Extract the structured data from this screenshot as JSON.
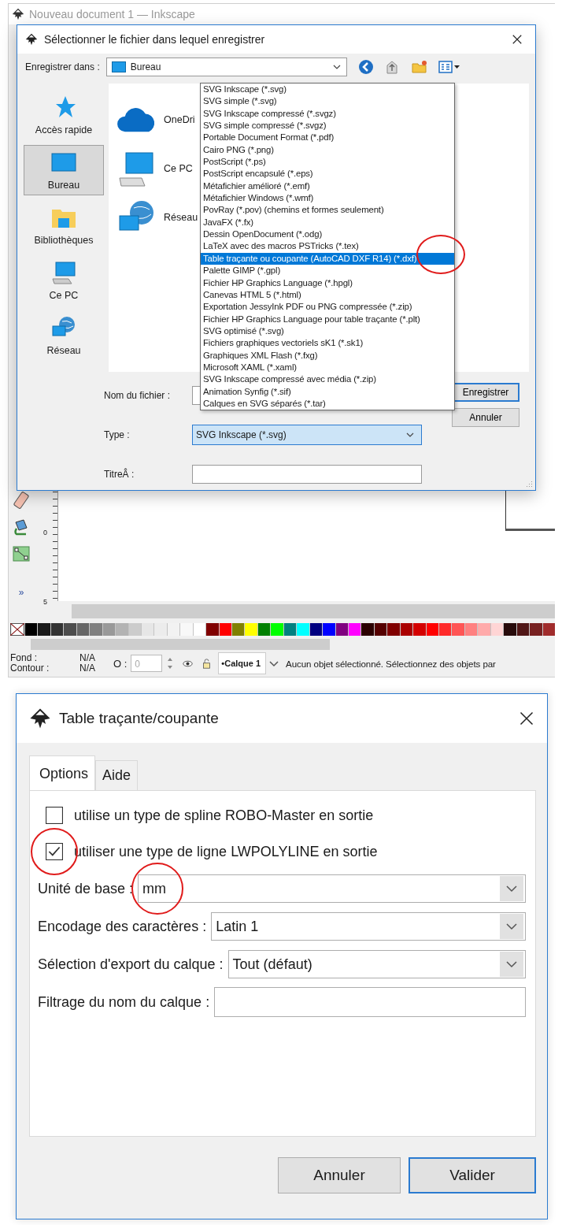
{
  "inkscape_window": {
    "title": "Nouveau document 1 — Inkscape",
    "toolbox_more": "»",
    "ruler_labels": [
      "0",
      "5"
    ],
    "palette": [
      {
        "color": "#000000"
      },
      {
        "color": "#1a1a1a"
      },
      {
        "color": "#333333"
      },
      {
        "color": "#4d4d4d"
      },
      {
        "color": "#666666"
      },
      {
        "color": "#808080"
      },
      {
        "color": "#999999"
      },
      {
        "color": "#b3b3b3"
      },
      {
        "color": "#cccccc"
      },
      {
        "color": "#e6e6e6"
      },
      {
        "color": "#ececec"
      },
      {
        "color": "#f2f2f2"
      },
      {
        "color": "#f8f8f8"
      },
      {
        "color": "#ffffff"
      },
      {
        "color": "#800000"
      },
      {
        "color": "#ff0000"
      },
      {
        "color": "#808000"
      },
      {
        "color": "#ffff00"
      },
      {
        "color": "#008000"
      },
      {
        "color": "#00ff00"
      },
      {
        "color": "#008080"
      },
      {
        "color": "#00ffff"
      },
      {
        "color": "#000080"
      },
      {
        "color": "#0000ff"
      },
      {
        "color": "#800080"
      },
      {
        "color": "#ff00ff"
      },
      {
        "color": "#2b0000"
      },
      {
        "color": "#550000"
      },
      {
        "color": "#800000"
      },
      {
        "color": "#aa0000"
      },
      {
        "color": "#d40000"
      },
      {
        "color": "#ff0000"
      },
      {
        "color": "#ff2a2a"
      },
      {
        "color": "#ff5555"
      },
      {
        "color": "#ff8080"
      },
      {
        "color": "#ffaaaa"
      },
      {
        "color": "#ffd5d5"
      },
      {
        "color": "#280b0b"
      },
      {
        "color": "#501616"
      },
      {
        "color": "#782121"
      },
      {
        "color": "#a02c2c"
      }
    ],
    "status_bar": {
      "fill_label": "Fond :",
      "fill_value": "N/A",
      "stroke_label": "Contour :",
      "stroke_value": "N/A",
      "opacity_label": "O :",
      "opacity_value": "0",
      "layer": "•Calque 1",
      "message": "Aucun objet sélectionné. Sélectionnez des objets par"
    }
  },
  "save_dialog": {
    "title": "Sélectionner le fichier dans lequel enregistrer",
    "location_label": "Enregistrer dans :",
    "location": "Bureau",
    "places": [
      {
        "label": "Accès rapide",
        "selected": false
      },
      {
        "label": "Bureau",
        "selected": true
      },
      {
        "label": "Bibliothèques",
        "selected": false
      },
      {
        "label": "Ce PC",
        "selected": false
      },
      {
        "label": "Réseau",
        "selected": false
      }
    ],
    "files": [
      "OneDri",
      "Ce PC",
      "Réseau"
    ],
    "filename_label": "Nom du fichier :",
    "type_label": "Type :",
    "type_value": "SVG Inkscape (*.svg)",
    "title_label": "TitreÂ :",
    "type_list": [
      {
        "label": "SVG Inkscape (*.svg)",
        "selected": false,
        "circled": false
      },
      {
        "label": "SVG simple (*.svg)",
        "selected": false,
        "circled": false
      },
      {
        "label": "SVG Inkscape compressé (*.svgz)",
        "selected": false,
        "circled": false
      },
      {
        "label": "SVG simple compressé (*.svgz)",
        "selected": false,
        "circled": false
      },
      {
        "label": "Portable Document Format (*.pdf)",
        "selected": false,
        "circled": false
      },
      {
        "label": "Cairo PNG (*.png)",
        "selected": false,
        "circled": false
      },
      {
        "label": "PostScript (*.ps)",
        "selected": false,
        "circled": false
      },
      {
        "label": "PostScript encapsulé (*.eps)",
        "selected": false,
        "circled": false
      },
      {
        "label": "Métafichier amélioré (*.emf)",
        "selected": false,
        "circled": false
      },
      {
        "label": "Métafichier Windows (*.wmf)",
        "selected": false,
        "circled": false
      },
      {
        "label": "PovRay (*.pov) (chemins et formes seulement)",
        "selected": false,
        "circled": false
      },
      {
        "label": "JavaFX (*.fx)",
        "selected": false,
        "circled": false
      },
      {
        "label": "Dessin OpenDocument (*.odg)",
        "selected": false,
        "circled": false
      },
      {
        "label": "LaTeX avec des macros PSTricks (*.tex)",
        "selected": false,
        "circled": false
      },
      {
        "label": "Table traçante ou coupante (AutoCAD DXF R14) (*.dxf)",
        "selected": true,
        "circled": true
      },
      {
        "label": "Palette GIMP (*.gpl)",
        "selected": false,
        "circled": false
      },
      {
        "label": "Fichier HP Graphics Language (*.hpgl)",
        "selected": false,
        "circled": false
      },
      {
        "label": "Canevas HTML 5 (*.html)",
        "selected": false,
        "circled": false
      },
      {
        "label": "Exportation JessyInk PDF ou PNG compressée (*.zip)",
        "selected": false,
        "circled": false
      },
      {
        "label": "Fichier HP Graphics Language pour table traçante (*.plt)",
        "selected": false,
        "circled": false
      },
      {
        "label": "SVG optimisé (*.svg)",
        "selected": false,
        "circled": false
      },
      {
        "label": "Fichiers graphiques vectoriels sK1 (*.sk1)",
        "selected": false,
        "circled": false
      },
      {
        "label": "Graphiques XML Flash (*.fxg)",
        "selected": false,
        "circled": false
      },
      {
        "label": "Microsoft XAML (*.xaml)",
        "selected": false,
        "circled": false
      },
      {
        "label": "SVG Inkscape compressé avec média (*.zip)",
        "selected": false,
        "circled": false
      },
      {
        "label": "Animation Synfig (*.sif)",
        "selected": false,
        "circled": false
      },
      {
        "label": "Calques en SVG séparés (*.tar)",
        "selected": false,
        "circled": false
      }
    ],
    "buttons": [
      {
        "label": "Enregistrer",
        "default": true
      },
      {
        "label": "Annuler",
        "default": false
      }
    ]
  },
  "export_dialog": {
    "title": "Table traçante/coupante",
    "tabs": [
      {
        "label": "Options",
        "selected": true
      },
      {
        "label": "Aide",
        "selected": false
      }
    ],
    "checkboxes": [
      {
        "label": "utilise un type de spline ROBO-Master en sortie",
        "checked": false,
        "circled": false
      },
      {
        "label": "utiliser une type de ligne LWPOLYLINE en sortie",
        "checked": true,
        "circled": true
      }
    ],
    "fields": [
      {
        "kind": "dropdown",
        "label": "Unité de base :",
        "value": "mm",
        "circled": true
      },
      {
        "kind": "dropdown",
        "label": "Encodage des caractères :",
        "value": "Latin 1",
        "circled": false
      },
      {
        "kind": "dropdown",
        "label": "Sélection d'export du calque :",
        "value": "Tout (défaut)",
        "circled": false
      },
      {
        "kind": "text",
        "label": "Filtrage du nom du calque :",
        "circled": false
      }
    ],
    "buttons": [
      {
        "label": "Annuler",
        "default": false
      },
      {
        "label": "Valider",
        "default": true
      }
    ]
  }
}
